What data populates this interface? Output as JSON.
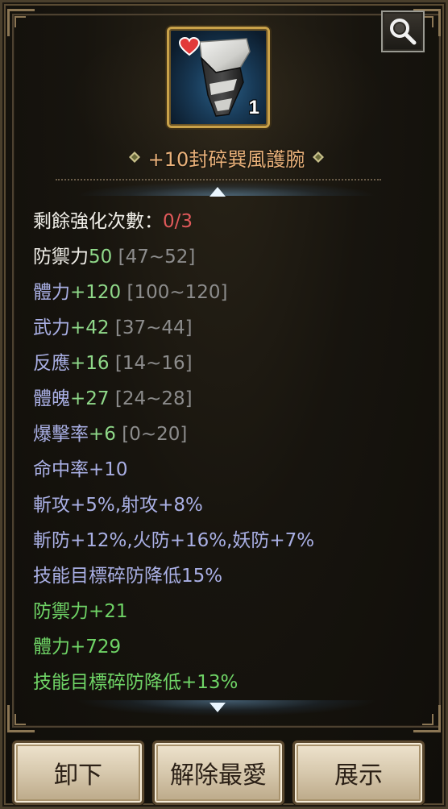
{
  "item": {
    "count": "1",
    "title": "+10封碎巽風護腕"
  },
  "stats": [
    {
      "parts": [
        {
          "text": "剩餘強化次數：",
          "color": "white"
        },
        {
          "text": "0/3",
          "color": "red"
        }
      ]
    },
    {
      "parts": [
        {
          "text": "防禦力",
          "color": "white"
        },
        {
          "text": "50",
          "color": "green"
        },
        {
          "text": " [47~52]",
          "color": "gray"
        }
      ]
    },
    {
      "parts": [
        {
          "text": "體力",
          "color": "lav"
        },
        {
          "text": "+120",
          "color": "green"
        },
        {
          "text": " [100~120]",
          "color": "gray"
        }
      ]
    },
    {
      "parts": [
        {
          "text": "武力",
          "color": "lav"
        },
        {
          "text": "+42",
          "color": "green"
        },
        {
          "text": " [37~44]",
          "color": "gray"
        }
      ]
    },
    {
      "parts": [
        {
          "text": "反應",
          "color": "lav"
        },
        {
          "text": "+16",
          "color": "green"
        },
        {
          "text": " [14~16]",
          "color": "gray"
        }
      ]
    },
    {
      "parts": [
        {
          "text": "體魄",
          "color": "lav"
        },
        {
          "text": "+27",
          "color": "green"
        },
        {
          "text": " [24~28]",
          "color": "gray"
        }
      ]
    },
    {
      "parts": [
        {
          "text": "爆擊率",
          "color": "lav"
        },
        {
          "text": "+6",
          "color": "green"
        },
        {
          "text": " [0~20]",
          "color": "gray"
        }
      ]
    },
    {
      "parts": [
        {
          "text": "命中率+10",
          "color": "lav"
        }
      ]
    },
    {
      "parts": [
        {
          "text": "斬攻+5%,射攻+8%",
          "color": "lav"
        }
      ]
    },
    {
      "parts": [
        {
          "text": "斬防+12%,火防+16%,妖防+7%",
          "color": "lav"
        }
      ]
    },
    {
      "parts": [
        {
          "text": "技能目標碎防降低15%",
          "color": "lav"
        }
      ]
    },
    {
      "parts": [
        {
          "text": "防禦力+21",
          "color": "bright-green"
        }
      ]
    },
    {
      "parts": [
        {
          "text": "體力+729",
          "color": "bright-green"
        }
      ]
    },
    {
      "parts": [
        {
          "text": "技能目標碎防降低+13%",
          "color": "bright-green"
        }
      ]
    }
  ],
  "buttons": {
    "unequip": "卸下",
    "unfavorite": "解除最愛",
    "show": "展示"
  },
  "icons": {
    "zoom": "magnifier-icon",
    "favorite": "heart-icon",
    "item": "bracer-icon",
    "title_left": "diamond-icon",
    "title_right": "diamond-icon",
    "scroll_up": "chevron-up-icon",
    "scroll_down": "chevron-down-icon"
  },
  "colors": {
    "title": "#e9b17a",
    "white": "#f1efe9",
    "red": "#e0595a",
    "lav": "#a9afe4",
    "green": "#8fd889",
    "gray": "#8c8c8c",
    "bright-green": "#6fd466",
    "slot_border": "#c9a24a"
  }
}
